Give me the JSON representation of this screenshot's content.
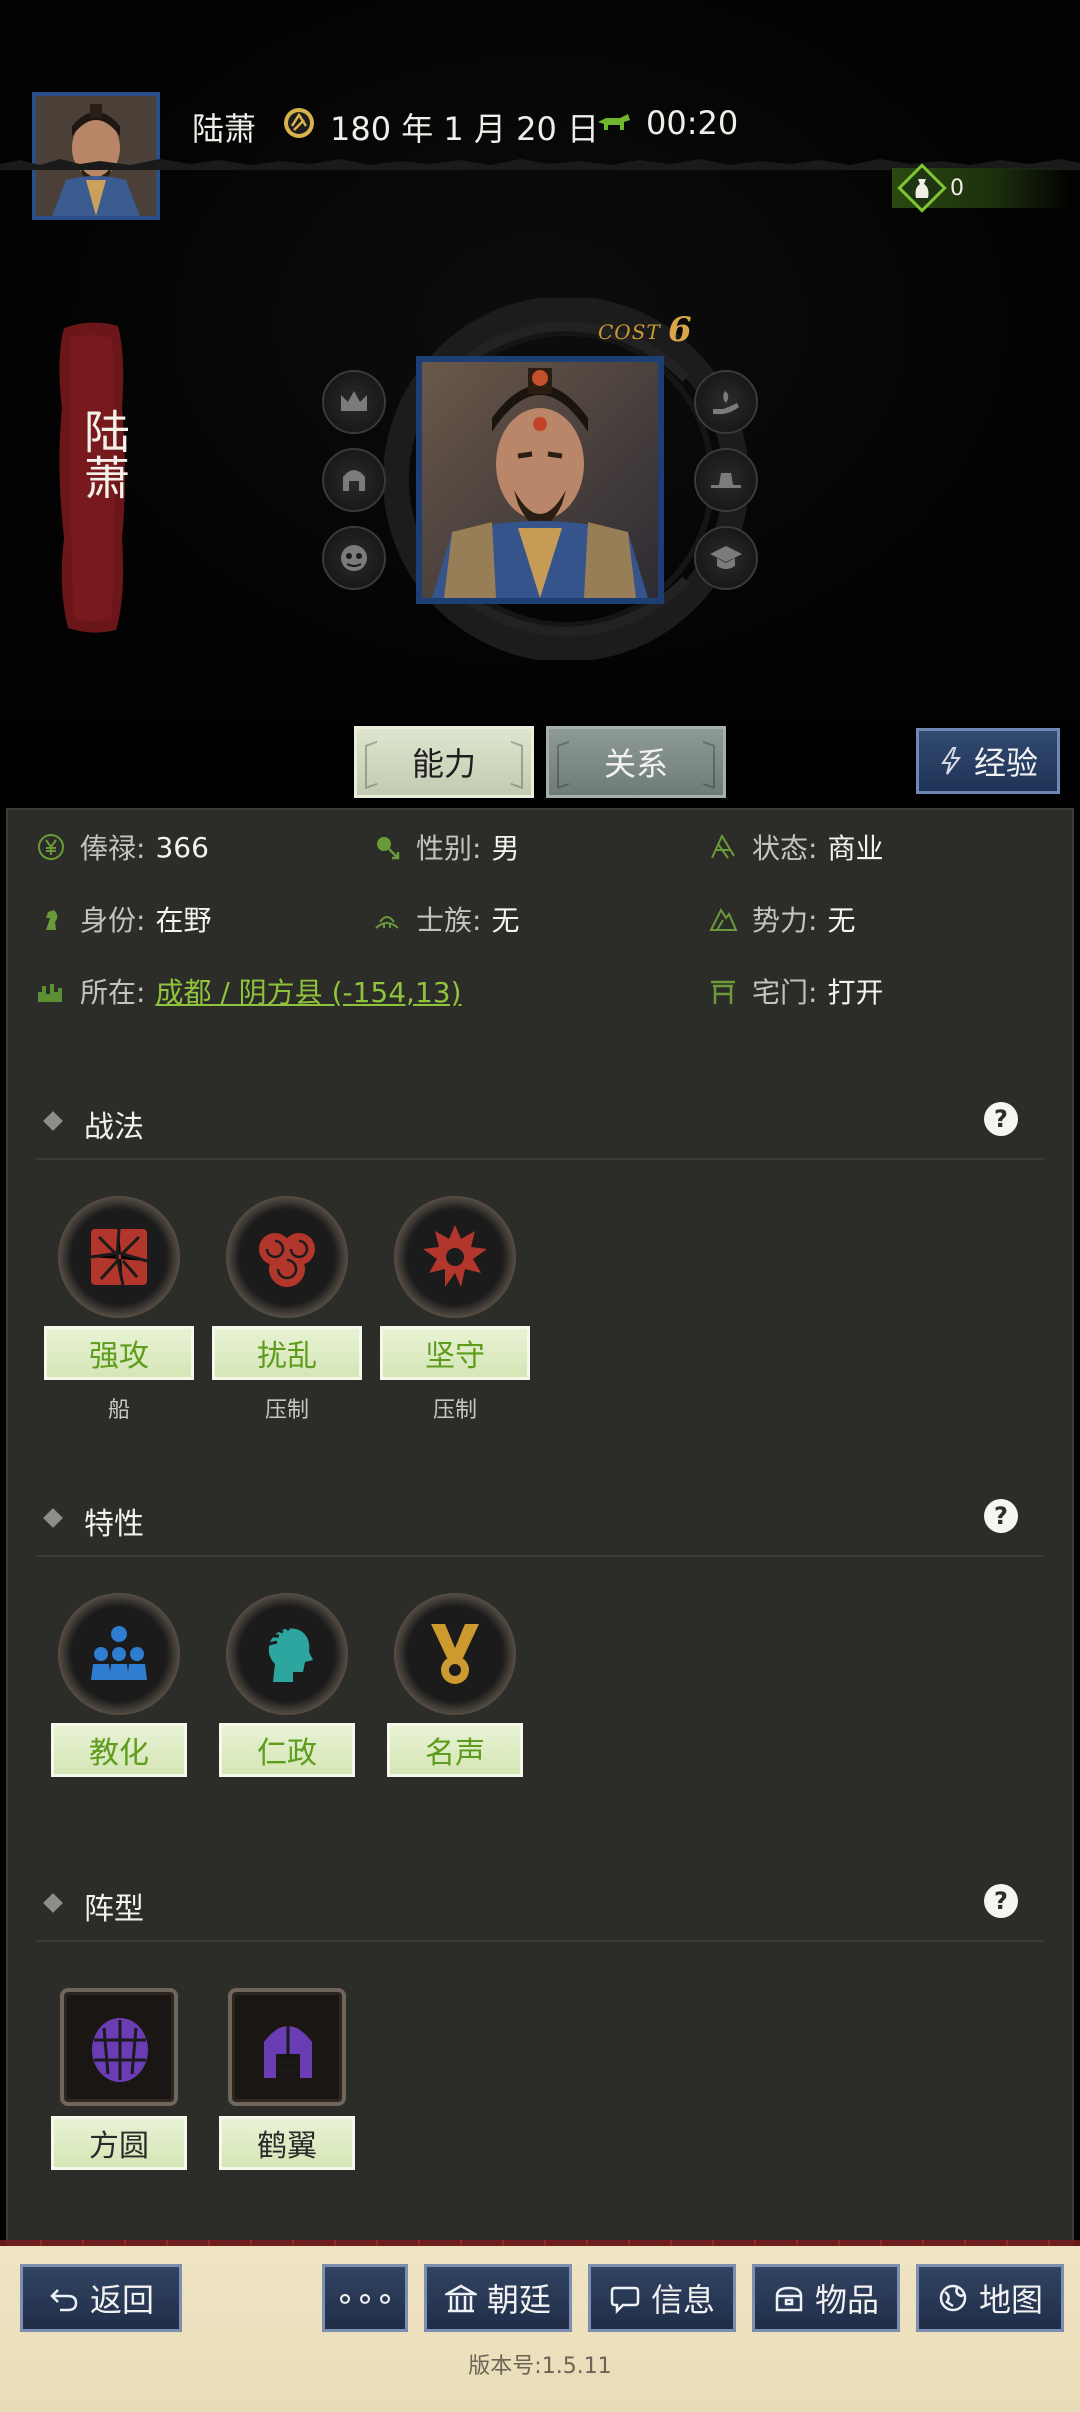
{
  "header": {
    "name": "陆萧",
    "date": "180 年 1 月 20 日",
    "time": "00:20",
    "season_icon": "season-badge-icon",
    "speed_icon": "horse-icon"
  },
  "resource": {
    "value": "0",
    "icon": "money-bag-icon"
  },
  "banner": {
    "name": "陆萧"
  },
  "cost": {
    "label": "COST",
    "value": "6"
  },
  "portrait_buttons": {
    "left": [
      "crown-icon",
      "helmet-icon",
      "mask-icon"
    ],
    "right": [
      "hand-seedling-icon",
      "hat-icon",
      "graduation-cap-icon"
    ]
  },
  "tabs": {
    "ability": "能力",
    "relation": "关系",
    "experience": "经验"
  },
  "info": {
    "salary_label": "俸禄:",
    "salary_value": "366",
    "gender_label": "性别:",
    "gender_value": "男",
    "status_label": "状态:",
    "status_value": "商业",
    "identity_label": "身份:",
    "identity_value": "在野",
    "clan_label": "士族:",
    "clan_value": "无",
    "faction_label": "势力:",
    "faction_value": "无",
    "location_label": "所在:",
    "location_value": "成都 / 阴方县 (-154,13)",
    "gate_label": "宅门:",
    "gate_value": "打开"
  },
  "sections": {
    "tactics": {
      "title": "战法",
      "help": "?",
      "items": [
        {
          "name": "强攻",
          "sub": "船",
          "color": "#c0392b"
        },
        {
          "name": "扰乱",
          "sub": "压制",
          "color": "#c0392b"
        },
        {
          "name": "坚守",
          "sub": "压制",
          "color": "#c0392b"
        }
      ]
    },
    "traits": {
      "title": "特性",
      "help": "?",
      "items": [
        {
          "name": "教化",
          "color": "#2a78c8"
        },
        {
          "name": "仁政",
          "color": "#2aa5a0"
        },
        {
          "name": "名声",
          "color": "#c8962a"
        }
      ]
    },
    "formations": {
      "title": "阵型",
      "help": "?",
      "items": [
        {
          "name": "方圆",
          "color": "#6a3fb0"
        },
        {
          "name": "鹤翼",
          "color": "#6a3fb0"
        }
      ]
    }
  },
  "nav": {
    "back": "返回",
    "more": "∘∘∘",
    "court": "朝廷",
    "info": "信息",
    "items": "物品",
    "map": "地图"
  },
  "version": "版本号:1.5.11"
}
